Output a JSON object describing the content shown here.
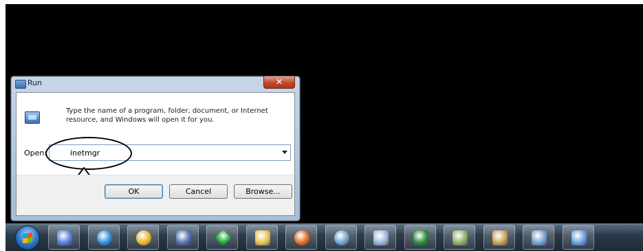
{
  "run_dialog": {
    "title": "Run",
    "close_label": "✕",
    "description": "Type the name of a program, folder, document, or Internet resource, and Windows will open it for you.",
    "open_label": "Open:",
    "open_value": "inetmgr",
    "ok_label": "OK",
    "cancel_label": "Cancel",
    "browse_label": "Browse..."
  },
  "taskbar": {
    "items": [
      {
        "icon": "windows-start-icon"
      },
      {
        "icon": "media-center-icon",
        "color": "#5a7fd6"
      },
      {
        "icon": "internet-explorer-icon",
        "color": "#2d8ee0"
      },
      {
        "icon": "chrome-icon",
        "color": "#e8b32a"
      },
      {
        "icon": "network-user-icon",
        "color": "#5571b0"
      },
      {
        "icon": "green-diamond-app-icon",
        "color": "#2fb34a"
      },
      {
        "icon": "windows-explorer-icon",
        "color": "#e8c25a"
      },
      {
        "icon": "firefox-icon",
        "color": "#e2691f"
      },
      {
        "icon": "globe-app-icon",
        "color": "#6fa0c8"
      },
      {
        "icon": "calculator-icon",
        "color": "#9fb8d8"
      },
      {
        "icon": "excel-icon",
        "color": "#2f8a3c"
      },
      {
        "icon": "image-viewer-icon",
        "color": "#8db06a"
      },
      {
        "icon": "photo-folder-icon",
        "color": "#c9a35a"
      },
      {
        "icon": "paint-icon",
        "color": "#7aa3d0"
      },
      {
        "icon": "run-dialog-taskbar-icon",
        "color": "#6f9fe0"
      }
    ]
  }
}
